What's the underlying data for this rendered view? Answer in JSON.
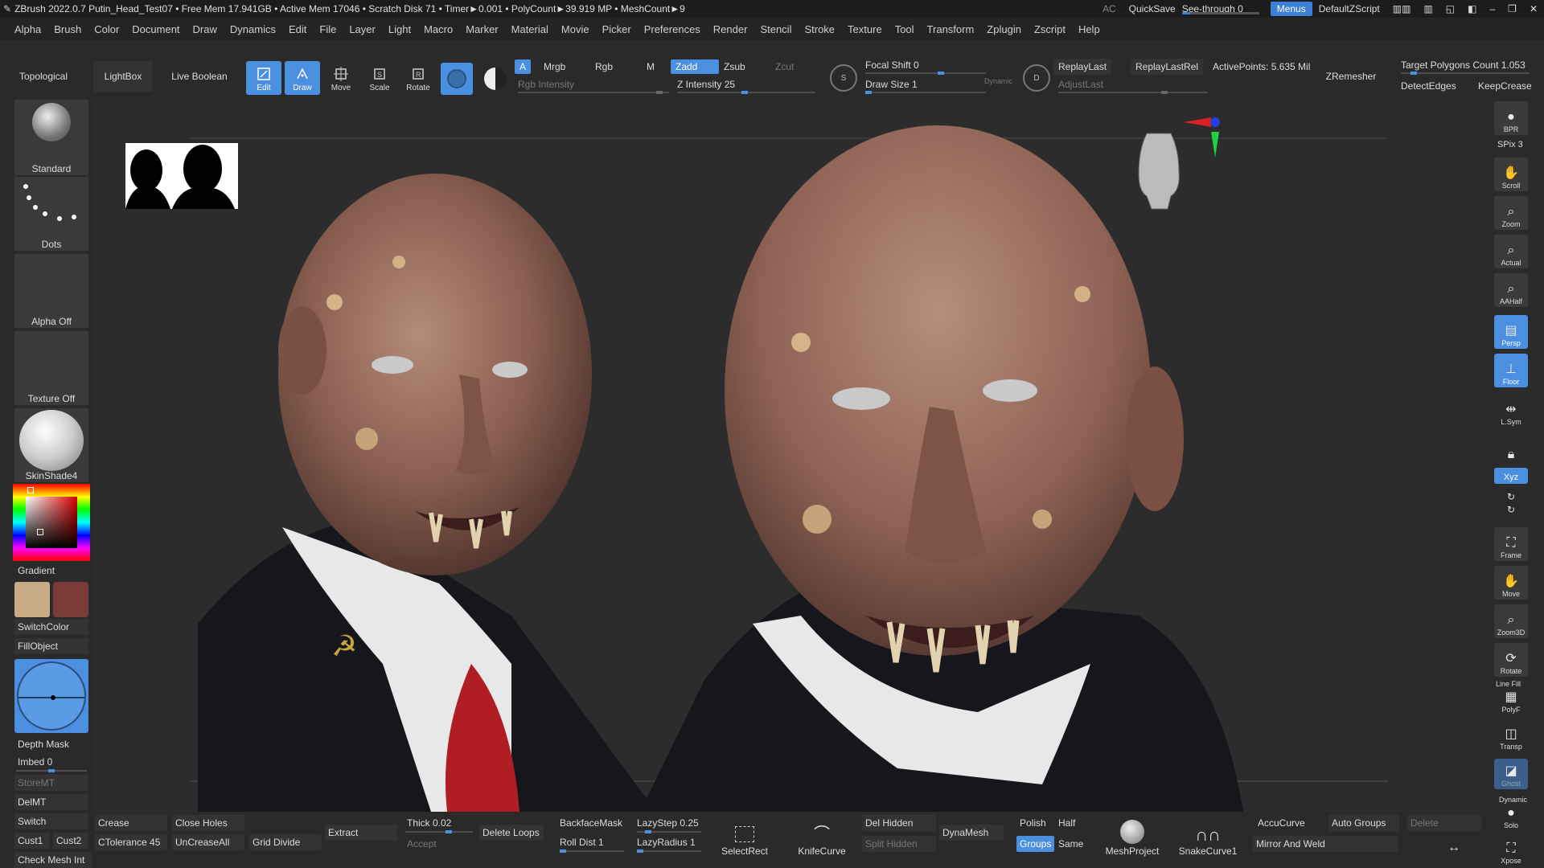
{
  "titlebar": {
    "title": "ZBrush 2022.0.7  Putin_Head_Test07  • Free Mem 17.941GB • Active Mem 17046 • Scratch Disk 71 • Timer►0.001 • PolyCount►39.919 MP • MeshCount►9",
    "ac": "AC",
    "quicksave": "QuickSave",
    "seethrough": "See-through  0",
    "menus": "Menus",
    "script": "DefaultZScript"
  },
  "menubar": [
    "Alpha",
    "Brush",
    "Color",
    "Document",
    "Draw",
    "Dynamics",
    "Edit",
    "File",
    "Layer",
    "Light",
    "Macro",
    "Marker",
    "Material",
    "Movie",
    "Picker",
    "Preferences",
    "Render",
    "Stencil",
    "Stroke",
    "Texture",
    "Tool",
    "Transform",
    "Zplugin",
    "Zscript",
    "Help"
  ],
  "shelf": {
    "topological": "Topological",
    "lightbox": "LightBox",
    "liveboolean": "Live Boolean",
    "tools": {
      "edit": "Edit",
      "draw": "Draw",
      "move": "Move",
      "scale": "Scale",
      "rotate": "Rotate"
    },
    "a": "A",
    "mrgb": "Mrgb",
    "rgb": "Rgb",
    "m": "M",
    "zadd": "Zadd",
    "zsub": "Zsub",
    "zcut": "Zcut",
    "rgb_intensity": "Rgb Intensity",
    "z_intensity": "Z Intensity 25",
    "focal_shift": "Focal Shift 0",
    "draw_size": "Draw Size 1",
    "dynamic": "Dynamic",
    "replaylast": "ReplayLast",
    "replaylastrel": "ReplayLastRel",
    "activepoints": "ActivePoints: 5.635 Mil",
    "adjustlast": "AdjustLast",
    "zremesher": "ZRemesher",
    "target_polys": "Target Polygons Count 1.053",
    "detectedges": "DetectEdges",
    "keepcrease": "KeepCrease"
  },
  "left": {
    "standard": "Standard",
    "dots": "Dots",
    "alpha_off": "Alpha Off",
    "texture_off": "Texture Off",
    "material": "SkinShade4",
    "gradient": "Gradient",
    "switchcolor": "SwitchColor",
    "fillobject": "FillObject",
    "depth_mask": "Depth Mask",
    "imbed": "Imbed 0",
    "storemt": "StoreMT",
    "delmt": "DelMT",
    "switch": "Switch",
    "cust1": "Cust1",
    "cust2": "Cust2",
    "checkmesh": "Check Mesh Int",
    "colors": {
      "main": "#c7ab86",
      "secondary": "#7a3a36"
    }
  },
  "right": {
    "bpr": "BPR",
    "spix": "SPix 3",
    "scroll": "Scroll",
    "zoom": "Zoom",
    "actual": "Actual",
    "aahalf": "AAHalf",
    "persp": "Persp",
    "floor": "Floor",
    "lsym": "L.Sym",
    "xyz": "Xyz",
    "frame": "Frame",
    "move": "Move",
    "zoom3d": "Zoom3D",
    "rotate": "Rotate",
    "linefill": "Line Fill",
    "polyf": "PolyF",
    "transp": "Transp",
    "ghost": "Ghost",
    "dynamic": "Dynamic",
    "solo": "Solo",
    "xpose": "Xpose"
  },
  "bottom": {
    "crease": "Crease",
    "ctolerance": "CTolerance 45",
    "closeholes": "Close Holes",
    "uncreaseall": "UnCreaseAll",
    "griddivide": "Grid Divide",
    "extract": "Extract",
    "thick": "Thick 0.02",
    "accept": "Accept",
    "deleteloops": "Delete Loops",
    "backfacemask": "BackfaceMask",
    "rolldist": "Roll Dist 1",
    "lazystep": "LazyStep 0.25",
    "lazyradius": "LazyRadius 1",
    "selectrect": "SelectRect",
    "knifecurve": "KnifeCurve",
    "delhidden": "Del Hidden",
    "splithidden": "Split Hidden",
    "dynamesh": "DynaMesh",
    "polish": "Polish",
    "half": "Half",
    "groups": "Groups",
    "same": "Same",
    "meshproject": "MeshProject",
    "snakecurve": "SnakeCurve1",
    "accucurve": "AccuCurve",
    "autogroups": "Auto Groups",
    "delete": "Delete",
    "mirrorweld": "Mirror And Weld"
  }
}
